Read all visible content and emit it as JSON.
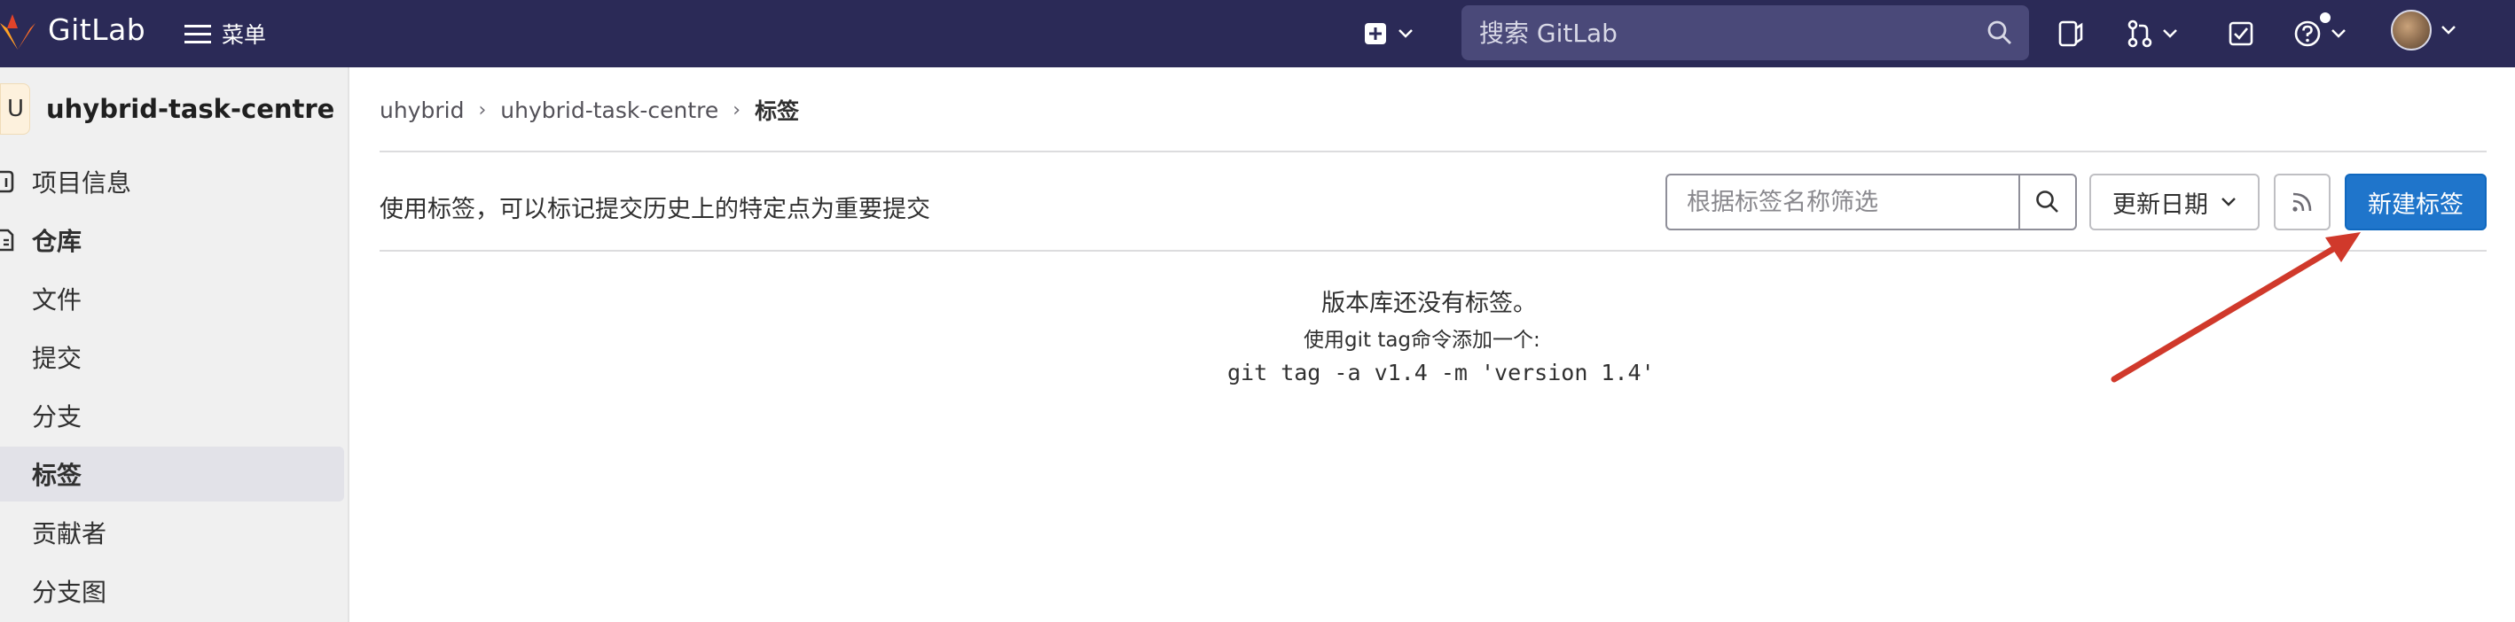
{
  "topbar": {
    "brand": "GitLab",
    "menu_label": "菜单",
    "search_placeholder": "搜索 GitLab"
  },
  "sidebar": {
    "project_initial": "U",
    "project_name": "uhybrid-task-centre",
    "items": [
      {
        "label": "项目信息",
        "icon": "info-icon"
      },
      {
        "label": "仓库",
        "icon": "repository-icon"
      },
      {
        "label": "文件"
      },
      {
        "label": "提交"
      },
      {
        "label": "分支"
      },
      {
        "label": "标签"
      },
      {
        "label": "贡献者"
      },
      {
        "label": "分支图"
      }
    ],
    "active_item": "标签"
  },
  "breadcrumb": [
    "uhybrid",
    "uhybrid-task-centre",
    "标签"
  ],
  "page": {
    "description": "使用标签，可以标记提交历史上的特定点为重要提交",
    "filter_placeholder": "根据标签名称筛选",
    "sort_label": "更新日期",
    "new_tag_label": "新建标签"
  },
  "empty_state": {
    "title": "版本库还没有标签。",
    "hint": "使用git tag命令添加一个:",
    "command": "git tag -a v1.4 -m 'version 1.4'"
  },
  "colors": {
    "topbar_bg": "#2b2a57",
    "primary": "#1f75cb",
    "annotation_arrow": "#d0392b"
  }
}
